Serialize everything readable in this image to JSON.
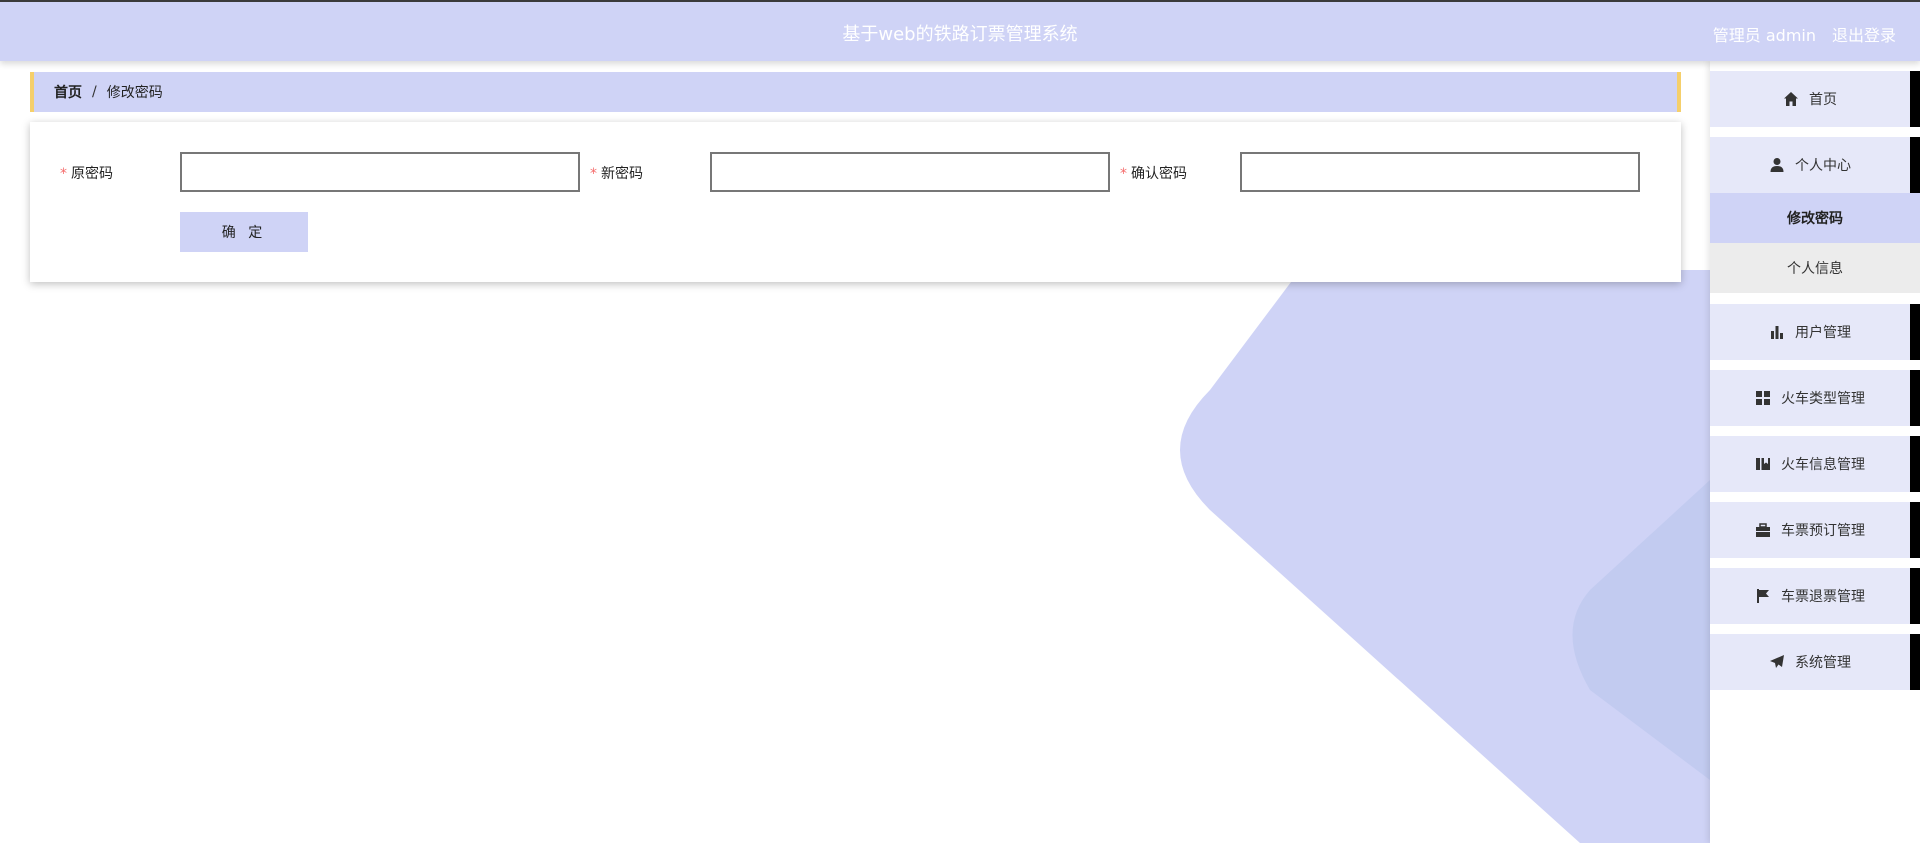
{
  "header": {
    "title": "基于web的铁路订票管理系统",
    "user": "管理员 admin",
    "logout": "退出登录"
  },
  "breadcrumb": {
    "home": "首页",
    "separator": "/",
    "current": "修改密码"
  },
  "form": {
    "old_password_label": "原密码",
    "new_password_label": "新密码",
    "confirm_password_label": "确认密码",
    "required_mark": "*",
    "old_password_value": "",
    "new_password_value": "",
    "confirm_password_value": "",
    "submit_label": "确 定"
  },
  "sidebar": {
    "home": "首页",
    "personal_center": "个人中心",
    "sub_change_password": "修改密码",
    "sub_personal_info": "个人信息",
    "items": [
      {
        "label": "用户管理",
        "icon": "bar-chart-icon"
      },
      {
        "label": "火车类型管理",
        "icon": "grid-icon"
      },
      {
        "label": "火车信息管理",
        "icon": "book-icon"
      },
      {
        "label": "车票预订管理",
        "icon": "briefcase-icon"
      },
      {
        "label": "车票退票管理",
        "icon": "flag-icon"
      },
      {
        "label": "系统管理",
        "icon": "paper-plane-icon"
      }
    ]
  },
  "colors": {
    "accent": "#cfd3f6",
    "breadcrumb_border": "#f5cf6b",
    "required": "#f56c6c"
  }
}
